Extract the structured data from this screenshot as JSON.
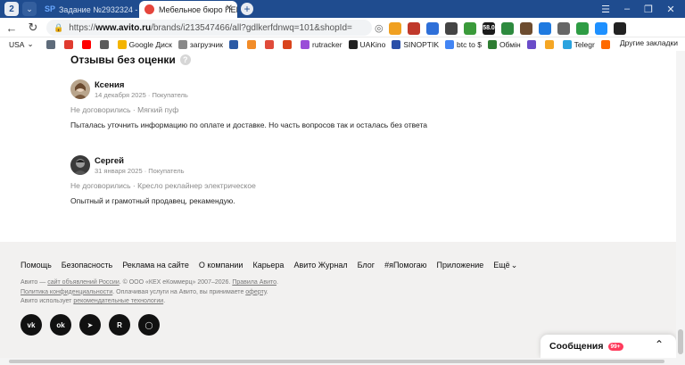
{
  "browser": {
    "tab_count": "2",
    "tabs": [
      {
        "label": "Задание №2932324 - про",
        "favicon": "SP"
      },
      {
        "label": "Мебельное бюро ПЕРЕ"
      }
    ],
    "address": {
      "scheme": "https://",
      "host": "www.avito.ru",
      "path": "/brands/i213547466/all?gdlkerfdnwq=101&shopId="
    },
    "extensions": [
      {
        "name": "shield-ext",
        "color": "#f0a020"
      },
      {
        "name": "red-ext",
        "color": "#c0392b"
      },
      {
        "name": "plane-ext",
        "color": "#2e6fd8"
      },
      {
        "name": "wallet-ext",
        "color": "#444444"
      },
      {
        "name": "chart-ext",
        "color": "#3a9a3a"
      },
      {
        "name": "ltc-ext",
        "color": "#1a1a1a",
        "text": "58.0"
      },
      {
        "name": "block-ext",
        "color": "#2d8a3e"
      },
      {
        "name": "box-ext",
        "color": "#6d4c2f"
      },
      {
        "name": "download-ext",
        "color": "#1f7ae0"
      },
      {
        "name": "puzzle-ext",
        "color": "#666666"
      },
      {
        "name": "arrow-ext",
        "color": "#2e9c44"
      },
      {
        "name": "s-ext",
        "color": "#1e90ff"
      },
      {
        "name": "dark-ext",
        "color": "#222222"
      }
    ],
    "bookmarks": [
      {
        "label": "USA",
        "color": "#ffffff"
      },
      {
        "label": "",
        "color": "#5e6b7a"
      },
      {
        "label": "",
        "color": "#e03b2f"
      },
      {
        "label": "",
        "color": "#ff0000"
      },
      {
        "label": "",
        "color": "#5b5b5b"
      },
      {
        "label": "Google Диск",
        "color": "#f4b400"
      },
      {
        "label": "загрузчик",
        "color": "#888888"
      },
      {
        "label": "",
        "color": "#2b5aa5"
      },
      {
        "label": "",
        "color": "#f28c28"
      },
      {
        "label": "",
        "color": "#e04b3a"
      },
      {
        "label": "",
        "color": "#d9441c"
      },
      {
        "label": "rutracker",
        "color": "#9a4dd8"
      },
      {
        "label": "UAKino",
        "color": "#222222"
      },
      {
        "label": "SINOPTIK",
        "color": "#2a4fa8"
      },
      {
        "label": "btc to $",
        "color": "#4285f4"
      },
      {
        "label": "Обмін",
        "color": "#2e7d32"
      },
      {
        "label": "",
        "color": "#6a4cc9"
      },
      {
        "label": "",
        "color": "#f5a623"
      },
      {
        "label": "Telegr",
        "color": "#2aa3df"
      },
      {
        "label": "",
        "color": "#ff6a00"
      }
    ],
    "bookmarks_other": "Другие закладки"
  },
  "reviews_section": {
    "title": "Отзывы без оценки",
    "reviews": [
      {
        "name": "Ксения",
        "meta": "14 декабря 2025 · Покупатель",
        "deal": "Не договорились · Мягкий пуф",
        "text": "Пыталась уточнить информацию по оплате и доставке. Но часть вопросов так и осталась без ответа"
      },
      {
        "name": "Сергей",
        "meta": "31 января 2025 · Покупатель",
        "deal": "Не договорились · Кресло реклайнер электрическое",
        "text": "Опытный и грамотный продавец, рекамендую."
      }
    ]
  },
  "footer": {
    "links": [
      "Помощь",
      "Безопасность",
      "Реклама на сайте",
      "О компании",
      "Карьера",
      "Авито Журнал",
      "Блог",
      "#яПомогаю",
      "Приложение",
      "Ещё"
    ],
    "legal": {
      "l1a": "Авито — ",
      "l1b": "сайт объявлений России",
      "l1c": ". © ООО «КЕХ еКоммерц» 2007–2026. ",
      "l1d": "Правила Авито",
      "l1e": ".",
      "l2a": "Политика конфиденциальности",
      "l2b": ". Оплачивая услуги на Авито, вы принимаете ",
      "l2c": "оферту",
      "l2d": ".",
      "l3a": "Авито использует ",
      "l3b": "рекомендательные технологии",
      "l3c": "."
    },
    "socials": [
      {
        "name": "vk",
        "label": "vk"
      },
      {
        "name": "ok",
        "label": "ok"
      },
      {
        "name": "telegram",
        "label": "➤"
      },
      {
        "name": "rutube",
        "label": "R"
      },
      {
        "name": "chat",
        "label": "◯"
      }
    ]
  },
  "messages": {
    "label": "Сообщения",
    "badge": "99+"
  }
}
